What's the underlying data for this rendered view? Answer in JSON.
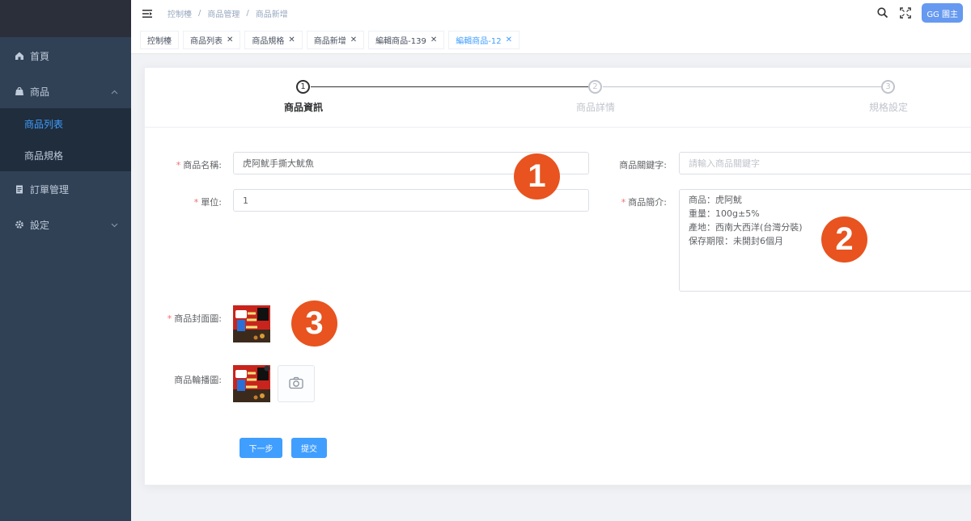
{
  "sidebar": {
    "items": [
      {
        "label": "首頁",
        "icon": "home-icon"
      },
      {
        "label": "商品",
        "icon": "shop-icon",
        "expanded": true,
        "children": [
          {
            "label": "商品列表",
            "active": true
          },
          {
            "label": "商品規格",
            "active": false
          }
        ]
      },
      {
        "label": "訂單管理",
        "icon": "clipboard-icon"
      },
      {
        "label": "設定",
        "icon": "gear-icon"
      }
    ]
  },
  "topbar": {
    "breadcrumb": [
      "控制檯",
      "商品管理",
      "商品新增"
    ],
    "user_button": "GG 園主"
  },
  "tags": [
    {
      "label": "控制檯",
      "closable": false,
      "active": false
    },
    {
      "label": "商品列表",
      "closable": true,
      "active": false
    },
    {
      "label": "商品規格",
      "closable": true,
      "active": false
    },
    {
      "label": "商品新增",
      "closable": true,
      "active": false
    },
    {
      "label": "編輯商品-139",
      "closable": true,
      "active": false
    },
    {
      "label": "編輯商品-12",
      "closable": true,
      "active": true
    }
  ],
  "steps": [
    {
      "number": "1",
      "label": "商品資訊",
      "active": true
    },
    {
      "number": "2",
      "label": "商品詳情",
      "active": false
    },
    {
      "number": "3",
      "label": "規格設定",
      "active": false
    }
  ],
  "form": {
    "name_label": "商品名稱:",
    "name_value": "虎阿魷手撕大魷魚",
    "unit_label": "單位:",
    "unit_value": "1",
    "keyword_label": "商品關鍵字:",
    "keyword_placeholder": "請輸入商品關鍵字",
    "intro_label": "商品簡介:",
    "intro_lines": [
      "商品：虎阿魷",
      "重量：100g±5%",
      "產地：西南大西洋(台灣分裝)",
      "保存期限：未開封6個月"
    ],
    "cover_label": "商品封面圖:",
    "carousel_label": "商品輪播圖:"
  },
  "buttons": {
    "next": "下一步",
    "submit": "提交"
  },
  "badges": [
    "1",
    "2",
    "3"
  ],
  "colors": {
    "accent": "#409eff",
    "sidebar": "#304156",
    "badge": "#e8531f"
  }
}
